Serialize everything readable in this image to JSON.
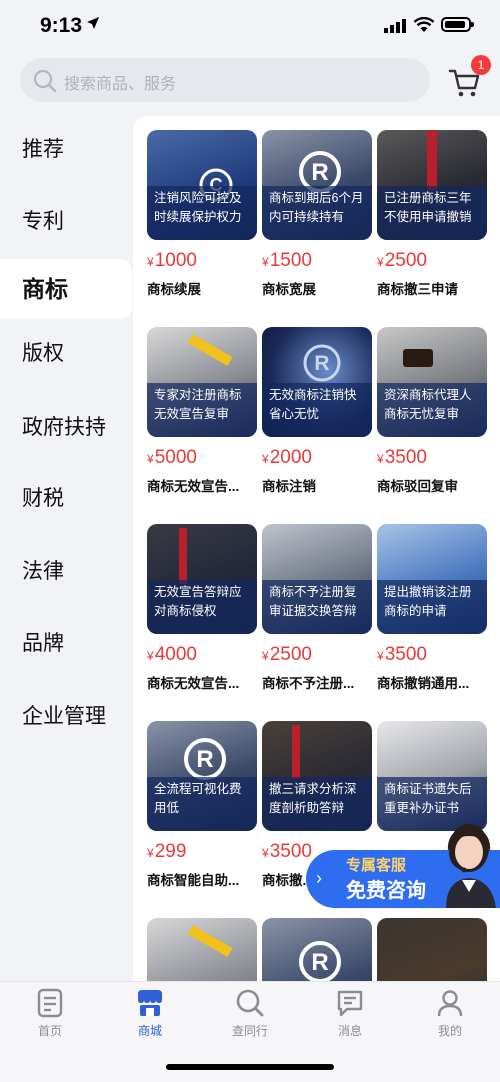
{
  "status": {
    "time": "9:13"
  },
  "search": {
    "placeholder": "搜索商品、服务"
  },
  "cart": {
    "badge": "1"
  },
  "categories": [
    "推荐",
    "专利",
    "商标",
    "版权",
    "政府扶持",
    "财税",
    "法律",
    "品牌",
    "企业管理"
  ],
  "active_category": "商标",
  "currency": "¥",
  "products": [
    {
      "caption": "注销风险可控及时续展保护权力",
      "price": "1000",
      "name": "商标续展"
    },
    {
      "caption": "商标到期后6个月内可持续持有",
      "price": "1500",
      "name": "商标宽展"
    },
    {
      "caption": "已注册商标三年不使用申请撤销",
      "price": "2500",
      "name": "商标撤三申请"
    },
    {
      "caption": "专家对注册商标无效宣告复审",
      "price": "5000",
      "name": "商标无效宣告..."
    },
    {
      "caption": "无效商标注销快省心无忧",
      "price": "2000",
      "name": "商标注销"
    },
    {
      "caption": "资深商标代理人商标无忧复审",
      "price": "3500",
      "name": "商标驳回复审"
    },
    {
      "caption": "无效宣告答辩应对商标侵权",
      "price": "4000",
      "name": "商标无效宣告..."
    },
    {
      "caption": "商标不予注册复审证据交换答辩",
      "price": "2500",
      "name": "商标不予注册..."
    },
    {
      "caption": "提出撤销该注册商标的申请",
      "price": "3500",
      "name": "商标撤销通用..."
    },
    {
      "caption": "全流程可视化费用低",
      "price": "299",
      "name": "商标智能自助..."
    },
    {
      "caption": "撤三请求分析深度剖析助答辩",
      "price": "3500",
      "name": "商标撤..."
    },
    {
      "caption": "商标证书遗失后重更补办证书",
      "price": "",
      "name": ""
    }
  ],
  "customer_service": {
    "line1": "专属客服",
    "line2": "免费咨询"
  },
  "tabs": [
    {
      "label": "首页",
      "icon": "document-icon"
    },
    {
      "label": "商城",
      "icon": "store-icon"
    },
    {
      "label": "查同行",
      "icon": "search-icon"
    },
    {
      "label": "消息",
      "icon": "message-icon"
    },
    {
      "label": "我的",
      "icon": "user-icon"
    }
  ],
  "colors": {
    "accent": "#2e5fd9",
    "price": "#e83a3a",
    "badge": "#f33b3b"
  }
}
